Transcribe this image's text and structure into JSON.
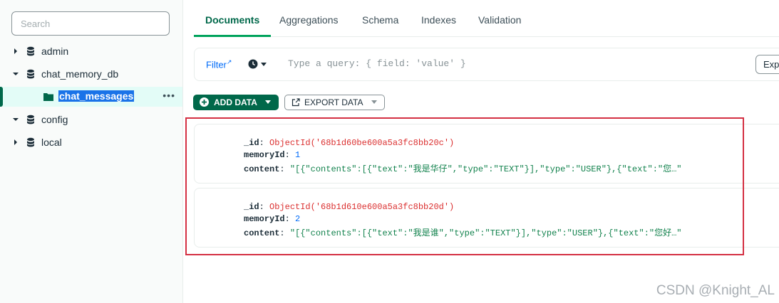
{
  "sidebar": {
    "search_placeholder": "Search",
    "items": [
      {
        "label": "admin",
        "expanded": false
      },
      {
        "label": "chat_memory_db",
        "expanded": true
      },
      {
        "label": "chat_messages",
        "selected": true
      },
      {
        "label": "config",
        "expanded": true
      },
      {
        "label": "local",
        "expanded": false
      }
    ]
  },
  "tabs": [
    "Documents",
    "Aggregations",
    "Schema",
    "Indexes",
    "Validation"
  ],
  "active_tab": "Documents",
  "query": {
    "filter_label": "Filter",
    "placeholder": "Type a query: { field: 'value' }",
    "explain_label": "Exp"
  },
  "toolbar": {
    "add_data": "ADD DATA",
    "export_data": "EXPORT DATA"
  },
  "documents": [
    {
      "id_key": "_id",
      "id_value": "ObjectId('68b1d60be600a5a3fc8bb20c')",
      "memory_key": "memoryId",
      "memory_value": "1",
      "content_key": "content",
      "content_value": "\"[{\"contents\":[{\"text\":\"我是华仔\",\"type\":\"TEXT\"}],\"type\":\"USER\"},{\"text\":\"您…\""
    },
    {
      "id_key": "_id",
      "id_value": "ObjectId('68b1d610e600a5a3fc8bb20d')",
      "memory_key": "memoryId",
      "memory_value": "2",
      "content_key": "content",
      "content_value": "\"[{\"contents\":[{\"text\":\"我是谁\",\"type\":\"TEXT\"}],\"type\":\"USER\"},{\"text\":\"您好…\""
    }
  ],
  "watermark": "CSDN @Knight_AL",
  "colors": {
    "accent": "#00684a",
    "highlight_box": "#d43043",
    "selected_bg": "#e3fcf7",
    "selection": "#1a73e8"
  }
}
